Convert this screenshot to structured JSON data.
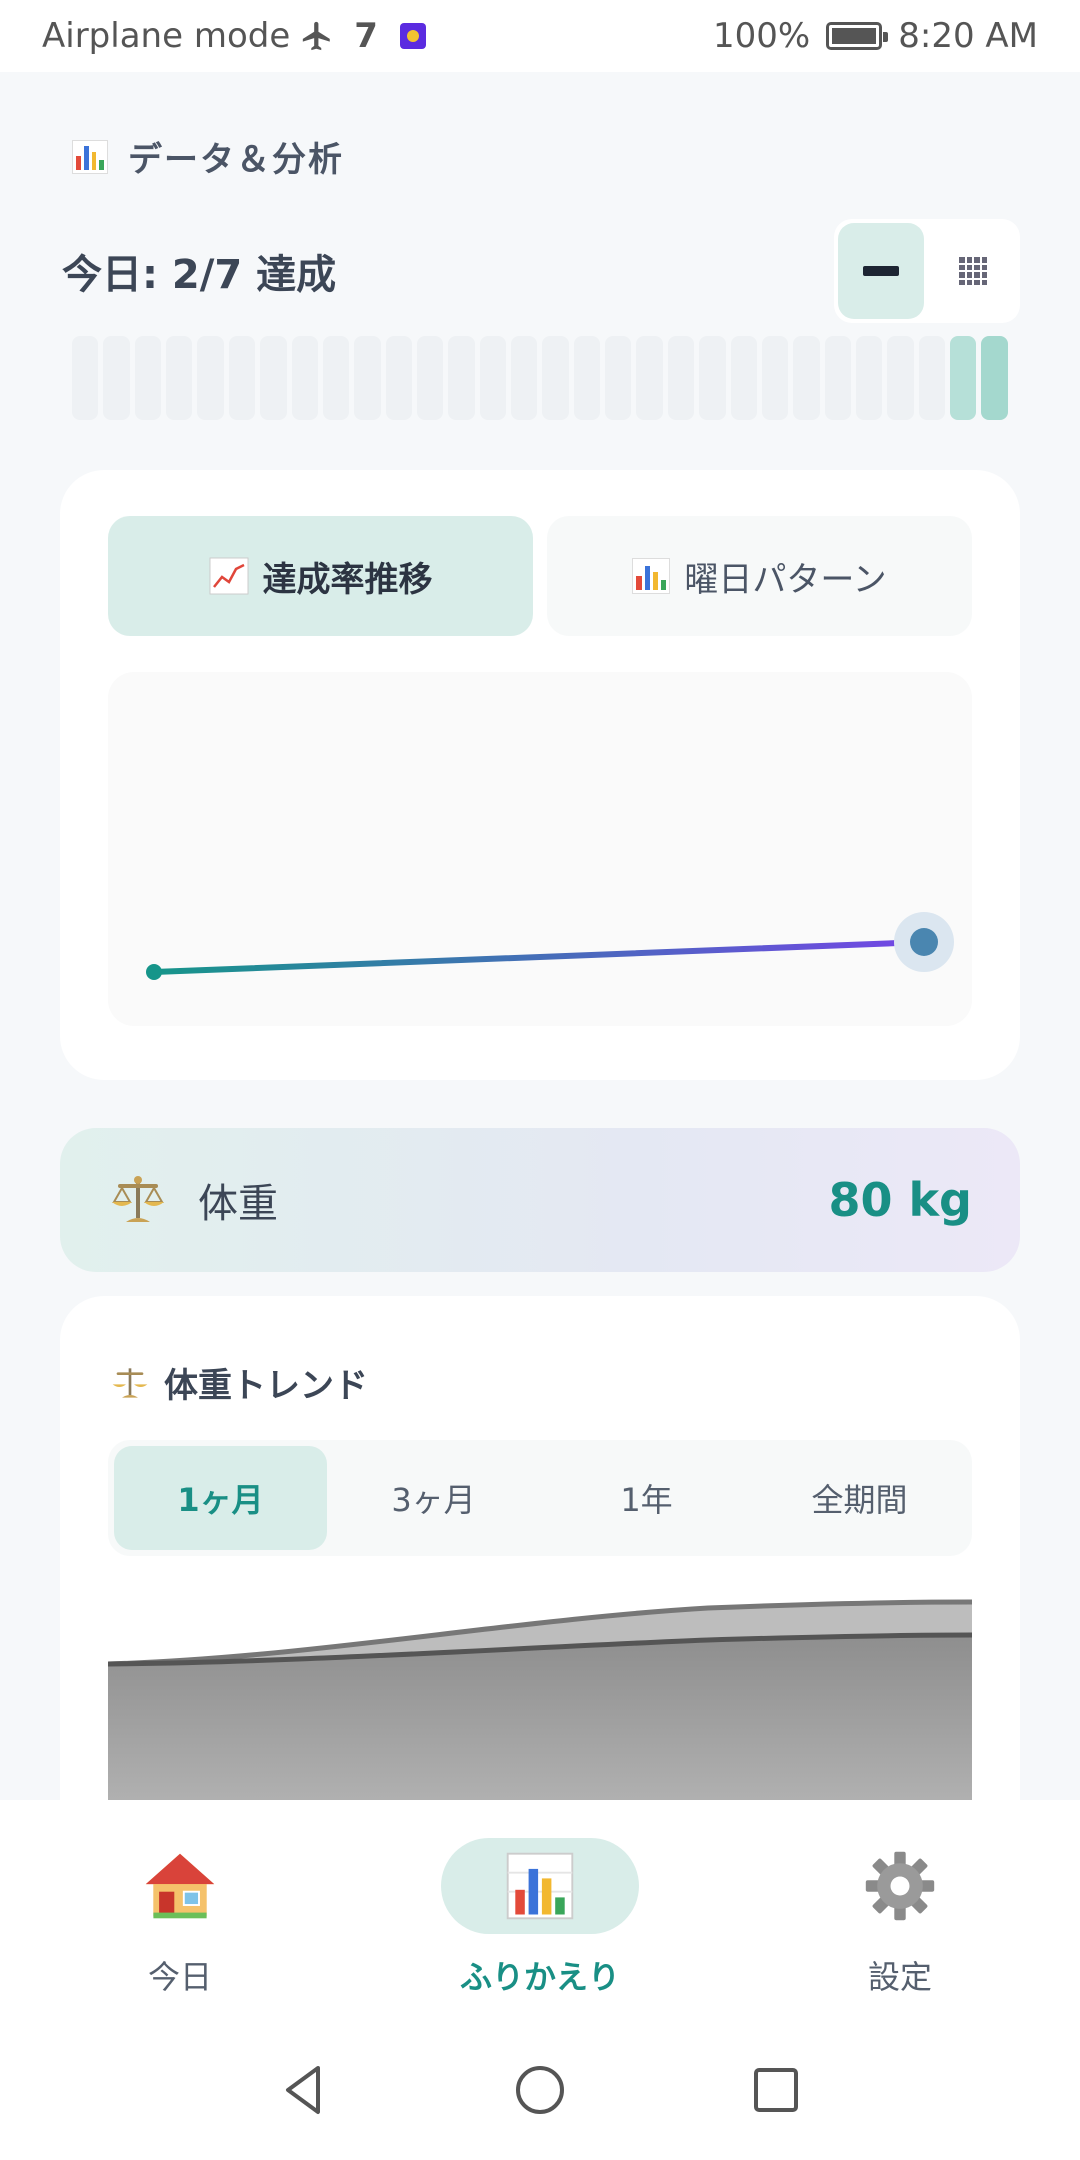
{
  "status_bar": {
    "left_text": "Airplane mode",
    "notification_count": "7",
    "battery": "100%",
    "time": "8:20 AM"
  },
  "header": {
    "title": "データ＆分析"
  },
  "today": {
    "summary": "今日: 2/7 達成"
  },
  "progress_strip": {
    "total_segments": 30,
    "filled_segments": 2
  },
  "trend_card": {
    "tabs": [
      {
        "label": "達成率推移"
      },
      {
        "label": "曜日パターン"
      }
    ],
    "active_tab": 0,
    "chart_data": {
      "type": "line",
      "x": [
        1,
        2
      ],
      "series": [
        {
          "values": [
            0.1,
            0.2
          ]
        }
      ],
      "title": "",
      "xlabel": "",
      "ylabel": "",
      "grid": false,
      "colors": {
        "start": "#16958a",
        "end": "#7446e6",
        "point": "#4a86b0"
      }
    }
  },
  "weight": {
    "label": "体重",
    "value": "80 kg"
  },
  "weight_trend": {
    "title": "体重トレンド",
    "ranges": [
      {
        "label": "1ヶ月"
      },
      {
        "label": "3ヶ月"
      },
      {
        "label": "1年"
      },
      {
        "label": "全期間"
      }
    ],
    "active_range": 0
  },
  "bottom_nav": {
    "items": [
      {
        "label": "今日",
        "icon": "house-icon"
      },
      {
        "label": "ふりかえり",
        "icon": "bar-chart-icon"
      },
      {
        "label": "設定",
        "icon": "gear-icon"
      }
    ],
    "active": 1
  },
  "colors": {
    "accent": "#198f85",
    "accent_bg": "#d9ede9"
  }
}
